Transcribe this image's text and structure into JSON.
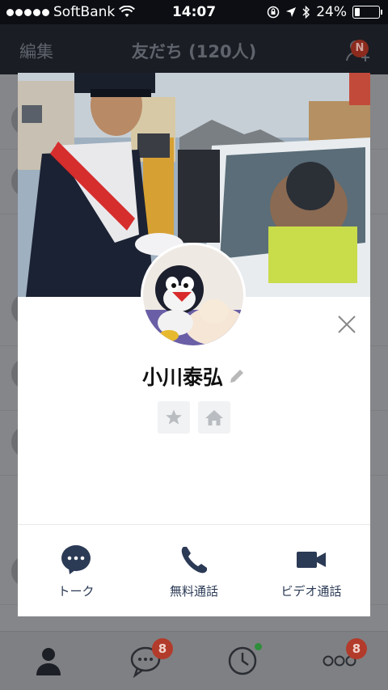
{
  "status_bar": {
    "carrier": "SoftBank",
    "time": "14:07",
    "battery": "24%",
    "battery_level": 0.24
  },
  "nav": {
    "edit_label": "編集",
    "title": "友だち (120人)",
    "badge": "N"
  },
  "profile": {
    "name": "小川泰弘",
    "actions": [
      {
        "label": "トーク",
        "icon": "chat-bubble-icon"
      },
      {
        "label": "無料通話",
        "icon": "phone-icon"
      },
      {
        "label": "ビデオ通話",
        "icon": "video-camera-icon"
      }
    ],
    "quick_icons": [
      "star-icon",
      "home-icon"
    ]
  },
  "tabbar": {
    "tabs": [
      {
        "name": "friends",
        "icon": "person-icon",
        "badge": ""
      },
      {
        "name": "chats",
        "icon": "chat-bubble-icon",
        "badge": "8"
      },
      {
        "name": "timeline",
        "icon": "clock-icon",
        "badge": ""
      },
      {
        "name": "more",
        "icon": "more-icon",
        "badge": "8"
      }
    ]
  },
  "colors": {
    "accent": "#2b3a55",
    "badge": "#b23b2b"
  }
}
